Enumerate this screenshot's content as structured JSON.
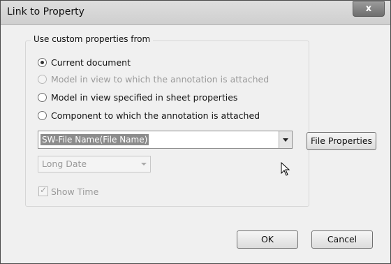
{
  "window": {
    "title": "Link to Property",
    "close_glyph": "x"
  },
  "group": {
    "legend": "Use custom properties from",
    "radios": [
      {
        "label": "Current document",
        "checked": true,
        "enabled": true
      },
      {
        "label": "Model in view to which the annotation is attached",
        "checked": false,
        "enabled": false
      },
      {
        "label": "Model in view specified in sheet properties",
        "checked": false,
        "enabled": true
      },
      {
        "label": "Component to which the annotation is attached",
        "checked": false,
        "enabled": true
      }
    ],
    "property_combo": {
      "value": "SW-File Name(File Name)"
    },
    "date_format": {
      "value": "Long Date",
      "enabled": false
    },
    "show_time": {
      "label": "Show Time",
      "checked": true,
      "enabled": false
    }
  },
  "buttons": {
    "file_properties": "File Properties",
    "ok": "OK",
    "cancel": "Cancel"
  },
  "icons": {
    "close": "close-icon",
    "combo_arrow": "chevron-down-icon",
    "pointer": "mouse-pointer-icon",
    "check": "checkmark-icon"
  }
}
